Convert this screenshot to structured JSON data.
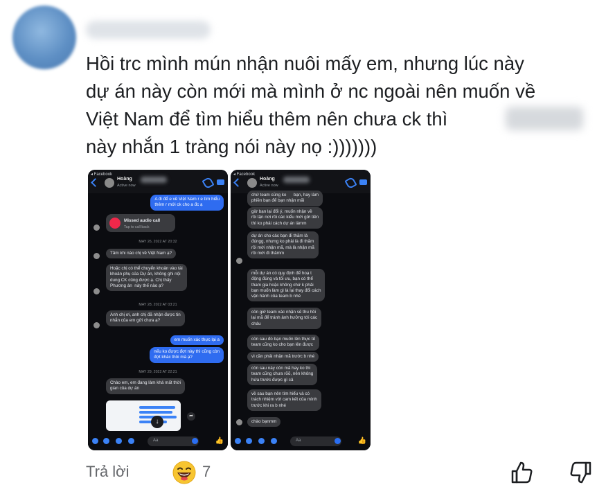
{
  "comment": {
    "text": "Hồi trc mình mún nhận nuôi mấy em, nhưng lúc này\ndự án này còn mới mà mình ở nc ngoài nên muốn về\nViệt Nam để tìm hiểu thêm nên chưa ck thì\nnày nhắn 1 tràng nói này nọ :)))))))"
  },
  "left_screenshot": {
    "back_label": "◂ Facebook",
    "contact_name": "Hoàng",
    "status": "Active now",
    "messages": [
      {
        "text": "A đi để e về Việt Nam r e tìm hiểu\nthêm r mới ck cho a đc ạ"
      },
      {
        "text": "Missed audio call"
      },
      {
        "text": "Tap to call back"
      },
      {
        "text": "MAY 26, 2022 AT 20:32"
      },
      {
        "text": "Tầm khi nào chị về Việt Nam ạ?"
      },
      {
        "text": "Hoặc chị có thể chuyển khoản vào tài\nkhoản phụ của Dự án, không ghi nội\ndung CK cũng được ạ. Chị thấy\nPhương án  này thế nào ạ?"
      },
      {
        "text": "MAY 28, 2022 AT 03:21"
      },
      {
        "text": "Anh chị ơi, anh chị đã nhận được tin\nnhắn của em gửi chưa ạ?"
      },
      {
        "text": "em muốn xác thực lại a"
      },
      {
        "text": "nếu ko được đợt này thì cũng còn\nđợt khác thôi mà ạ?"
      },
      {
        "text": "MAY 29, 2022 AT 22:21"
      },
      {
        "text": "Chào em, em đang làm khá mất thời\ngian của dự án"
      }
    ],
    "composer_placeholder": "Aa"
  },
  "right_screenshot": {
    "back_label": "◂ Facebook",
    "contact_name": "Hoàng",
    "status": "Active now",
    "messages": [
      {
        "text": "chứ team cũng ko      bạn, hay làm\nphiền bạn để bạn nhận mãi"
      },
      {
        "text": "giờ bạn lại đổi ý, muốn nhận về\nrồi tận nơi rồi các kiểu mới gửi tiền\nthì ko phải cách dự án làmm"
      },
      {
        "text": "dự án cho các bạn đi thăm là\nđúngg, nhưng ko phải là đi thăm\nrồi mới nhận mã, mà là nhận mã\nrồi mới đi thămm"
      },
      {
        "text": "mỗi dự án có quy định để hoạ t\nđộng đúng và tối ưu, bạn có thể\ntham gia hoặc không chứ k phải\nbạn muốn làm gì là lại thay đổi cách\nvận hành của team b nhé"
      },
      {
        "text": "còn giờ team xác nhận sẽ thu hồi\nlại mã để tránh ảnh hưởng tới các\ncháu"
      },
      {
        "text": "còn sau đó bạn muốn lên thực tế\nteam cũng ko cho bạn lên được"
      },
      {
        "text": "vì cần phải nhận mã trước b nhé"
      },
      {
        "text": "còn sau này còn mã hay ko thì\nteam cũng chưa rõõ, nên không\nhứa trước được gì cả"
      },
      {
        "text": "về sau bạn nên tìm hiểu và có\ntrách nhiệm với cam kết của mình\ntrước khi ra b nhé"
      },
      {
        "text": "chào bạnmm"
      }
    ],
    "composer_placeholder": "Aa"
  },
  "footer": {
    "reply_label": "Trả lời",
    "reaction_count": "7",
    "reaction_icon": "laughing-face-icon",
    "like_icon": "thumbs-up-icon",
    "dislike_icon": "thumbs-down-icon"
  },
  "colors": {
    "comment_text": "#1c1e21",
    "secondary_text": "#65676b",
    "messenger_blue": "#2f6cf0",
    "dark_bg": "#0b0c10",
    "incoming_bubble": "#3a3b3f"
  }
}
